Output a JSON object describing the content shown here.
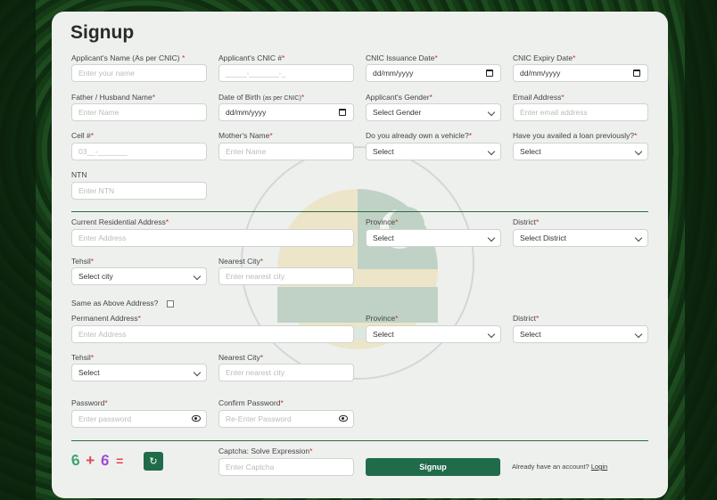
{
  "page": {
    "title": "Signup"
  },
  "row1": {
    "name_label": "Applicant's Name (As per CNIC)",
    "name_placeholder": "Enter your name",
    "cnic_label": "Applicant's CNIC #",
    "cnic_placeholder": "_____-_______-_",
    "issue_label": "CNIC Issuance Date",
    "issue_value": "dd/mm/yyyy",
    "expiry_label": "CNIC Expiry Date",
    "expiry_value": "dd/mm/yyyy"
  },
  "row2": {
    "father_label": "Father / Husband Name",
    "father_placeholder": "Enter Name",
    "dob_label": "Date of Birth",
    "dob_note": "(as per CNIC)",
    "dob_value": "dd/mm/yyyy",
    "gender_label": "Applicant's Gender",
    "gender_value": "Select Gender",
    "email_label": "Email Address",
    "email_placeholder": "Enter email address"
  },
  "row3": {
    "cell_label": "Cell #",
    "cell_placeholder": "03__-_______",
    "mother_label": "Mother's Name",
    "mother_placeholder": "Enter Name",
    "vehicle_label": "Do you already own a vehicle?",
    "vehicle_value": "Select",
    "loan_label": "Have you availed a loan previously?",
    "loan_value": "Select"
  },
  "row4": {
    "ntn_label": "NTN",
    "ntn_placeholder": "Enter NTN"
  },
  "current": {
    "address_label": "Current Residential Address",
    "address_placeholder": "Enter Address",
    "province_label": "Province",
    "province_value": "Select",
    "district_label": "District",
    "district_value": "Select District",
    "tehsil_label": "Tehsil",
    "tehsil_value": "Select city",
    "city_label": "Nearest City",
    "city_placeholder": "Enter nearest city"
  },
  "same_label": "Same as Above Address?",
  "permanent": {
    "address_label": "Permanent Address",
    "address_placeholder": "Enter Address",
    "province_label": "Province",
    "province_value": "Select",
    "district_label": "District",
    "district_value": "Select",
    "tehsil_label": "Tehsil",
    "tehsil_value": "Select",
    "city_label": "Nearest City",
    "city_placeholder": "Enter nearest city"
  },
  "password": {
    "password_label": "Password",
    "password_placeholder": "Enter password",
    "confirm_label": "Confirm Password",
    "confirm_placeholder": "Re-Enter Password"
  },
  "captcha": {
    "label": "Captcha: Solve Expression",
    "placeholder": "Enter Captcha",
    "a": "6",
    "op": "+",
    "b": "6",
    "eq": "="
  },
  "actions": {
    "signup": "Signup",
    "have_account": "Already have an account?",
    "login": "Login"
  },
  "colors": {
    "brand": "#1f6b4a",
    "required": "#c0392b"
  },
  "icons": [
    "calendar-icon",
    "chevron-down-icon",
    "eye-icon",
    "refresh-icon",
    "emblem-watermark"
  ]
}
